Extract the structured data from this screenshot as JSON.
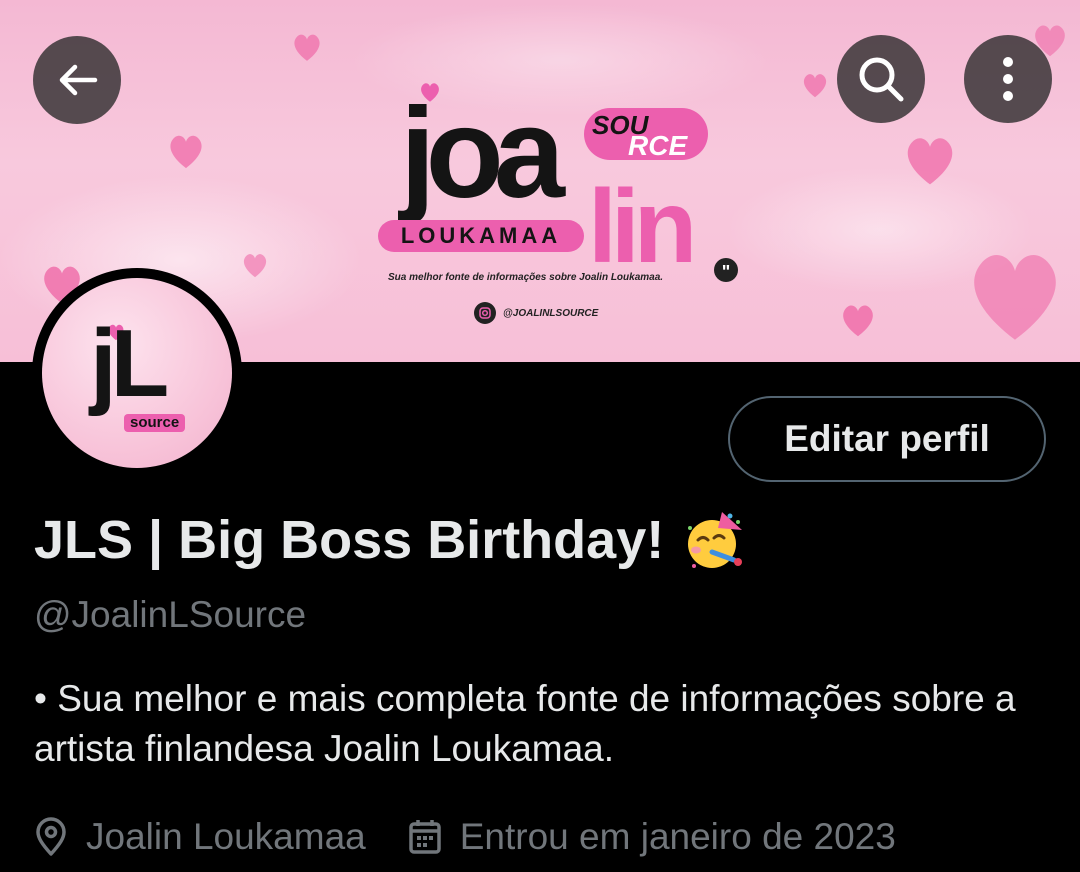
{
  "banner": {
    "logo_joa": "joa",
    "logo_lin": "lin",
    "logo_sou": "SOU",
    "logo_rce": "RCE",
    "logo_loukamaa": "LOUKAMAA",
    "tagline": "Sua melhor fonte de informações sobre Joalin Loukamaa.",
    "instagram_handle": "@JOALINLSOURCE",
    "accent_color": "#ec5fae"
  },
  "nav": {
    "back_icon": "arrow-left-icon",
    "search_icon": "search-icon",
    "more_icon": "more-vertical-icon"
  },
  "avatar": {
    "logo_jl": "jL",
    "logo_source": "source"
  },
  "profile": {
    "edit_button": "Editar perfil",
    "display_name": "JLS | Big Boss Birthday!",
    "display_name_emoji": "partying-face-emoji",
    "username": "@JoalinLSource",
    "bio": "• Sua melhor e mais completa fonte de informações sobre a artista finlandesa Joalin Loukamaa.",
    "location": "Joalin Loukamaa",
    "joined": "Entrou em janeiro de 2023"
  }
}
